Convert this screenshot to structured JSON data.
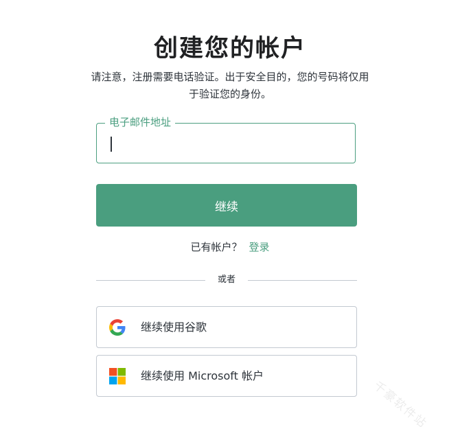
{
  "header": {
    "title": "创建您的帐户",
    "subtitle": "请注意，注册需要电话验证。出于安全目的，您的号码将仅用于验证您的身份。"
  },
  "form": {
    "email_label": "电子邮件地址",
    "email_value": "",
    "continue_label": "继续"
  },
  "login": {
    "question": "已有帐户？",
    "link_label": "登录"
  },
  "divider": {
    "label": "或者"
  },
  "social": [
    {
      "label": "继续使用谷歌",
      "icon": "google-icon"
    },
    {
      "label": "继续使用 Microsoft 帐户",
      "icon": "microsoft-icon"
    }
  ],
  "watermark": {
    "text": "千豪软件站"
  },
  "colors": {
    "accent": "#4a9e7f",
    "text": "#2d333a",
    "border": "#c2c8d0"
  }
}
